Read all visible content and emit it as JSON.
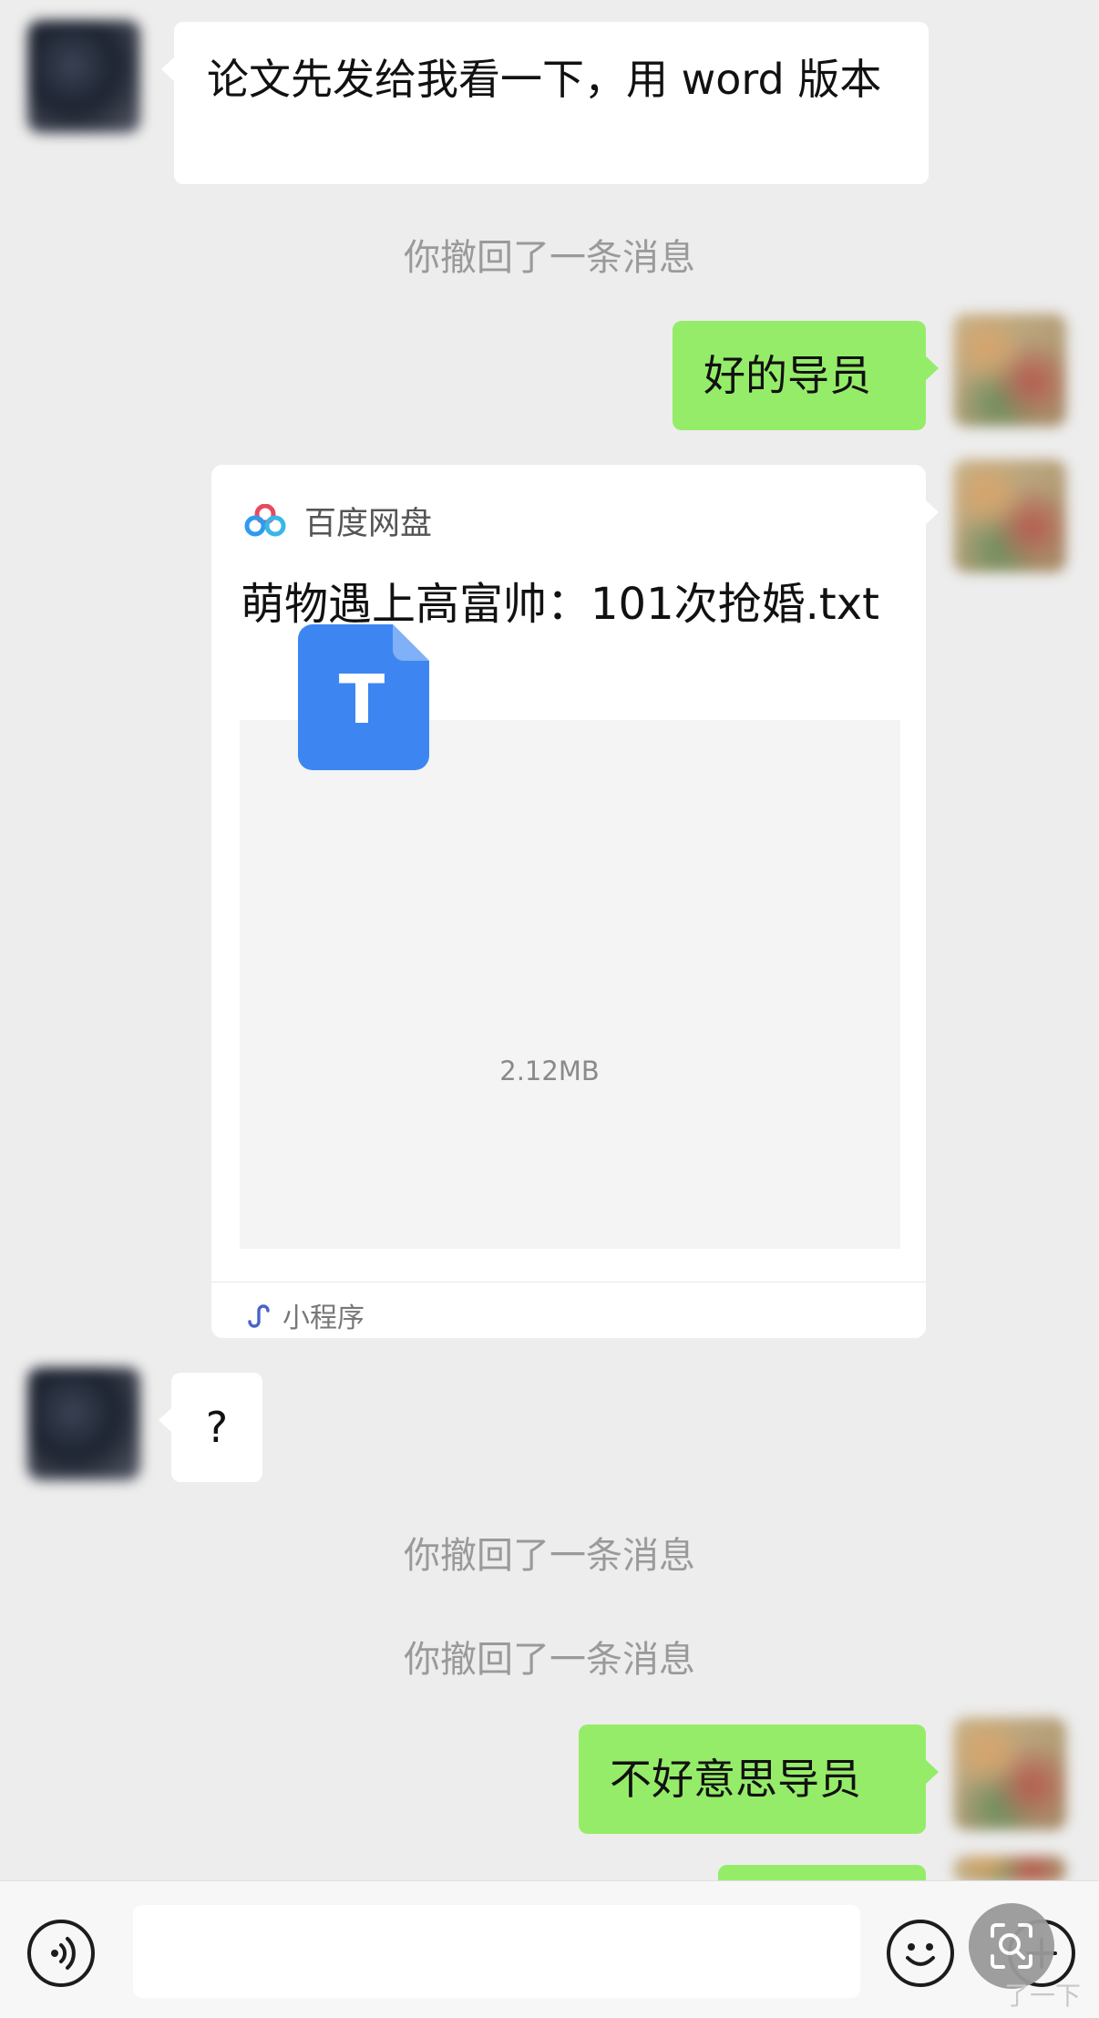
{
  "messages": [
    {
      "from": "mentor",
      "type": "text",
      "text": "论文先发给我看一下，用 word 版本"
    },
    {
      "type": "system",
      "text": "你撤回了一条消息"
    },
    {
      "from": "me",
      "type": "text",
      "text": "好的导员"
    },
    {
      "from": "me",
      "type": "mini_program",
      "source": "百度网盘",
      "title": "萌物遇上高富帅：101次抢婚.txt",
      "file_icon_letter": "T",
      "file_size": "2.12MB",
      "footer": "小程序"
    },
    {
      "from": "mentor",
      "type": "text",
      "text": "?"
    },
    {
      "type": "system",
      "text": "你撤回了一条消息"
    },
    {
      "type": "system",
      "text": "你撤回了一条消息"
    },
    {
      "from": "me",
      "type": "text",
      "text": "不好意思导员"
    }
  ],
  "input": {
    "placeholder": ""
  },
  "watermark": "了一下",
  "colors": {
    "background": "#ededed",
    "my_bubble": "#95ec69",
    "their_bubble": "#ffffff",
    "file_icon": "#3d86f2"
  },
  "icons": {
    "voice": "voice-icon",
    "emoji": "emoji-icon",
    "more": "plus-icon",
    "lens": "image-search-icon",
    "baidu": "baidu-netdisk-logo",
    "mini_program": "mini-program-icon"
  }
}
